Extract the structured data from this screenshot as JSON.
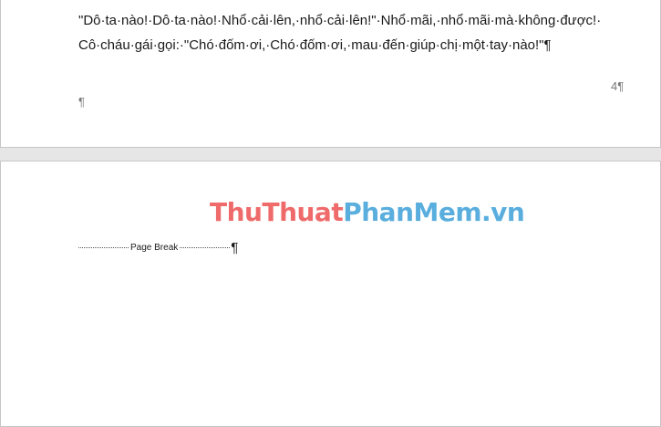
{
  "page1": {
    "line1": "\"Dô·ta·nào!·Dô·ta·nào!·Nhổ·cải·lên,·nhổ·cải·lên!\"·Nhổ·mãi,·nhổ·mãi·mà·không·được!·",
    "line2": "Cô·cháu·gái·gọi:·\"Chó·đốm·ơi,·Chó·đốm·ơi,·mau·đến·giúp·chị·một·tay·nào!\"¶",
    "page_number": "4¶",
    "empty_paragraph_mark": "¶"
  },
  "page2": {
    "watermark_part1": "ThuThuat",
    "watermark_part2": "PhanMem.vn",
    "page_break_label": "Page Break",
    "page_break_pilcrow": "¶"
  },
  "colors": {
    "watermark_red": "#ef6a6a",
    "watermark_blue": "#5aaede",
    "page_gap": "#e6e6e6"
  }
}
